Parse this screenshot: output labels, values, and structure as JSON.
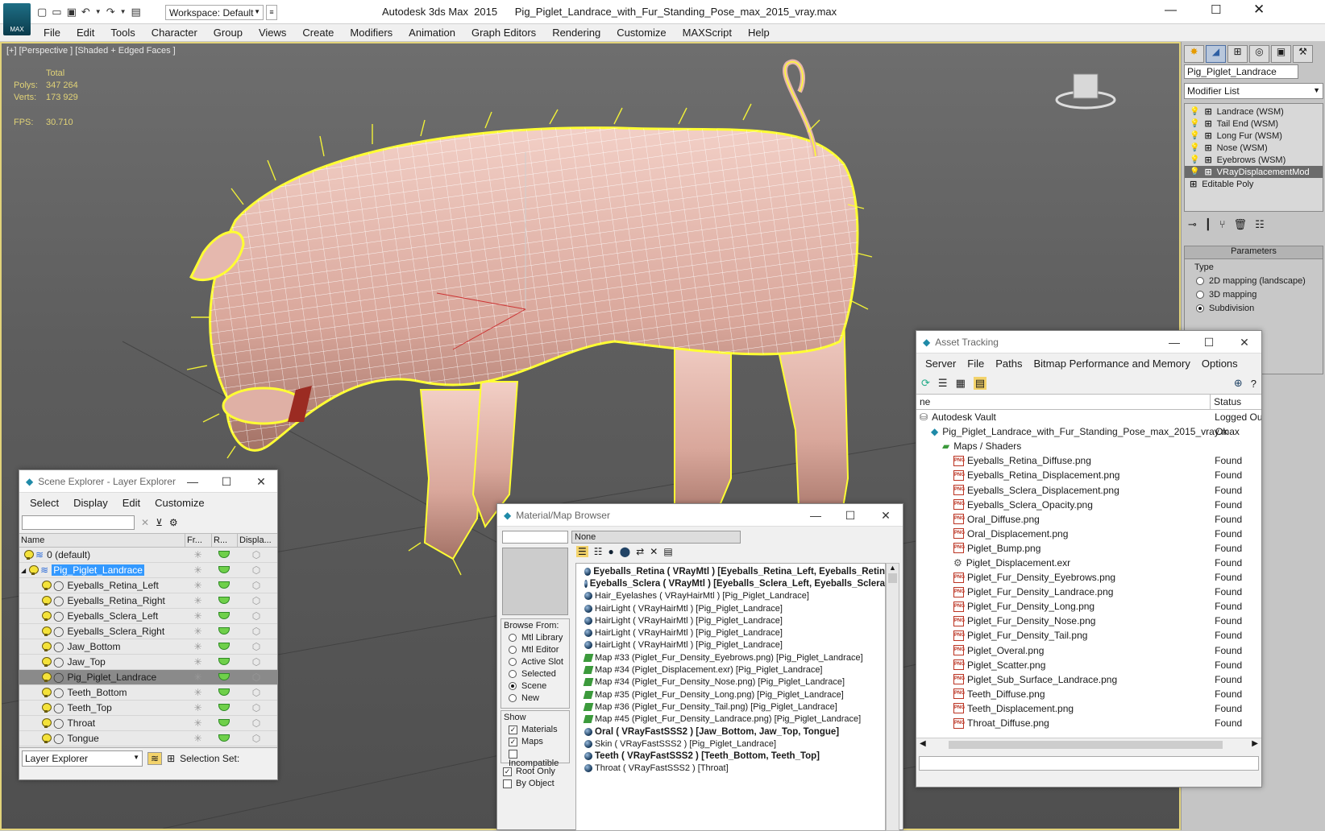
{
  "window": {
    "title": "Autodesk 3ds Max  2015      Pig_Piglet_Landrace_with_Fur_Standing_Pose_max_2015_vray.max",
    "app_logo": "MAX",
    "workspace": "Workspace: Default"
  },
  "menu": [
    "File",
    "Edit",
    "Tools",
    "Character",
    "Group",
    "Views",
    "Create",
    "Modifiers",
    "Animation",
    "Graph Editors",
    "Rendering",
    "Customize",
    "MAXScript",
    "Help"
  ],
  "viewport": {
    "label": "[+] [Perspective ] [Shaded + Edged Faces ]",
    "stats": {
      "total_label": "Total",
      "polys_label": "Polys:",
      "polys": "347 264",
      "verts_label": "Verts:",
      "verts": "173 929",
      "fps_label": "FPS:",
      "fps": "30.710"
    }
  },
  "command_panel": {
    "object_name": "Pig_Piglet_Landrace",
    "modifier_list": "Modifier List",
    "modifiers": [
      "Landrace (WSM)",
      "Tail End (WSM)",
      "Long Fur (WSM)",
      "Nose (WSM)",
      "Eyebrows (WSM)",
      "VRayDisplacementMod",
      "Editable Poly"
    ],
    "selected_modifier": "VRayDisplacementMod",
    "rollout": "Parameters",
    "type_label": "Type",
    "types": [
      "2D mapping (landscape)",
      "3D mapping",
      "Subdivision"
    ],
    "selected_type": "Subdivision"
  },
  "scene_explorer": {
    "title": "Scene Explorer - Layer Explorer",
    "menu": [
      "Select",
      "Display",
      "Edit",
      "Customize"
    ],
    "columns": [
      "Name",
      "Fr...",
      "R...",
      "Displa..."
    ],
    "rows": [
      {
        "name": "0 (default)",
        "level": 0
      },
      {
        "name": "Pig_Piglet_Landrace",
        "level": 0
      },
      {
        "name": "Eyeballs_Retina_Left",
        "level": 1
      },
      {
        "name": "Eyeballs_Retina_Right",
        "level": 1
      },
      {
        "name": "Eyeballs_Sclera_Left",
        "level": 1
      },
      {
        "name": "Eyeballs_Sclera_Right",
        "level": 1
      },
      {
        "name": "Jaw_Bottom",
        "level": 1
      },
      {
        "name": "Jaw_Top",
        "level": 1
      },
      {
        "name": "Pig_Piglet_Landrace",
        "level": 1
      },
      {
        "name": "Teeth_Bottom",
        "level": 1
      },
      {
        "name": "Teeth_Top",
        "level": 1
      },
      {
        "name": "Throat",
        "level": 1
      },
      {
        "name": "Tongue",
        "level": 1
      }
    ],
    "footer_layer": "Layer Explorer",
    "selection_set": "Selection Set:"
  },
  "material_browser": {
    "title": "Material/Map Browser",
    "name_field": "None",
    "browse_from_label": "Browse From:",
    "browse_from": [
      "Mtl Library",
      "Mtl Editor",
      "Active Slot",
      "Selected",
      "Scene",
      "New"
    ],
    "selected_browse": "Scene",
    "show_label": "Show",
    "show": [
      {
        "label": "Materials",
        "checked": true
      },
      {
        "label": "Maps",
        "checked": true
      },
      {
        "label": "Incompatible",
        "checked": false
      }
    ],
    "root_only": "Root Only",
    "by_object": "By Object",
    "items": [
      {
        "text": "Eyeballs_Retina  ( VRayMtl )  [Eyeballs_Retina_Left, Eyeballs_Retin",
        "kind": "mtl",
        "bold": true
      },
      {
        "text": "Eyeballs_Sclera  ( VRayMtl )  [Eyeballs_Sclera_Left, Eyeballs_Sclera",
        "kind": "mtl",
        "bold": true
      },
      {
        "text": "Hair_Eyelashes  ( VRayHairMtl )  [Pig_Piglet_Landrace]",
        "kind": "mtl",
        "bold": false
      },
      {
        "text": "HairLight  ( VRayHairMtl )  [Pig_Piglet_Landrace]",
        "kind": "mtl",
        "bold": false
      },
      {
        "text": "HairLight  ( VRayHairMtl )  [Pig_Piglet_Landrace]",
        "kind": "mtl",
        "bold": false
      },
      {
        "text": "HairLight  ( VRayHairMtl )  [Pig_Piglet_Landrace]",
        "kind": "mtl",
        "bold": false
      },
      {
        "text": "HairLight  ( VRayHairMtl )  [Pig_Piglet_Landrace]",
        "kind": "mtl",
        "bold": false
      },
      {
        "text": "Map #33 (Piglet_Fur_Density_Eyebrows.png)  [Pig_Piglet_Landrace]",
        "kind": "map",
        "bold": false
      },
      {
        "text": "Map #34 (Piglet_Displacement.exr)  [Pig_Piglet_Landrace]",
        "kind": "map",
        "bold": false
      },
      {
        "text": "Map #34 (Piglet_Fur_Density_Nose.png)  [Pig_Piglet_Landrace]",
        "kind": "map",
        "bold": false
      },
      {
        "text": "Map #35 (Piglet_Fur_Density_Long.png)  [Pig_Piglet_Landrace]",
        "kind": "map",
        "bold": false
      },
      {
        "text": "Map #36 (Piglet_Fur_Density_Tail.png)  [Pig_Piglet_Landrace]",
        "kind": "map",
        "bold": false
      },
      {
        "text": "Map #45 (Piglet_Fur_Density_Landrace.png)  [Pig_Piglet_Landrace]",
        "kind": "map",
        "bold": false
      },
      {
        "text": "Oral  ( VRayFastSSS2 )  [Jaw_Bottom, Jaw_Top, Tongue]",
        "kind": "mtl",
        "bold": true
      },
      {
        "text": "Skin  ( VRayFastSSS2 )  [Pig_Piglet_Landrace]",
        "kind": "mtl",
        "bold": false
      },
      {
        "text": "Teeth  ( VRayFastSSS2 )  [Teeth_Bottom, Teeth_Top]",
        "kind": "mtl",
        "bold": true
      },
      {
        "text": "Throat  ( VRayFastSSS2 )  [Throat]",
        "kind": "mtl",
        "bold": false
      }
    ]
  },
  "asset_tracking": {
    "title": "Asset Tracking",
    "menu": [
      "Server",
      "File",
      "Paths",
      "Bitmap Performance and Memory",
      "Options"
    ],
    "col_name": "ne",
    "col_status": "Status",
    "rows": [
      {
        "name": "Autodesk Vault",
        "status": "Logged Ou",
        "icon": "vault",
        "level": 0
      },
      {
        "name": "Pig_Piglet_Landrace_with_Fur_Standing_Pose_max_2015_vray.max",
        "status": "Ok",
        "icon": "max",
        "level": 1
      },
      {
        "name": "Maps / Shaders",
        "status": "",
        "icon": "folder",
        "level": 2
      },
      {
        "name": "Eyeballs_Retina_Diffuse.png",
        "status": "Found",
        "icon": "png",
        "level": 3
      },
      {
        "name": "Eyeballs_Retina_Displacement.png",
        "status": "Found",
        "icon": "png",
        "level": 3
      },
      {
        "name": "Eyeballs_Sclera_Displacement.png",
        "status": "Found",
        "icon": "png",
        "level": 3
      },
      {
        "name": "Eyeballs_Sclera_Opacity.png",
        "status": "Found",
        "icon": "png",
        "level": 3
      },
      {
        "name": "Oral_Diffuse.png",
        "status": "Found",
        "icon": "png",
        "level": 3
      },
      {
        "name": "Oral_Displacement.png",
        "status": "Found",
        "icon": "png",
        "level": 3
      },
      {
        "name": "Piglet_Bump.png",
        "status": "Found",
        "icon": "png",
        "level": 3
      },
      {
        "name": "Piglet_Displacement.exr",
        "status": "Found",
        "icon": "gear",
        "level": 3
      },
      {
        "name": "Piglet_Fur_Density_Eyebrows.png",
        "status": "Found",
        "icon": "png",
        "level": 3
      },
      {
        "name": "Piglet_Fur_Density_Landrace.png",
        "status": "Found",
        "icon": "png",
        "level": 3
      },
      {
        "name": "Piglet_Fur_Density_Long.png",
        "status": "Found",
        "icon": "png",
        "level": 3
      },
      {
        "name": "Piglet_Fur_Density_Nose.png",
        "status": "Found",
        "icon": "png",
        "level": 3
      },
      {
        "name": "Piglet_Fur_Density_Tail.png",
        "status": "Found",
        "icon": "png",
        "level": 3
      },
      {
        "name": "Piglet_Overal.png",
        "status": "Found",
        "icon": "png",
        "level": 3
      },
      {
        "name": "Piglet_Scatter.png",
        "status": "Found",
        "icon": "png",
        "level": 3
      },
      {
        "name": "Piglet_Sub_Surface_Landrace.png",
        "status": "Found",
        "icon": "png",
        "level": 3
      },
      {
        "name": "Teeth_Diffuse.png",
        "status": "Found",
        "icon": "png",
        "level": 3
      },
      {
        "name": "Teeth_Displacement.png",
        "status": "Found",
        "icon": "png",
        "level": 3
      },
      {
        "name": "Throat_Diffuse.png",
        "status": "Found",
        "icon": "png",
        "level": 3
      }
    ]
  },
  "colors": {
    "accent": "#3a7bd5",
    "selected_row": "#3399ff",
    "viewport_border": "#e2d37a",
    "fur": "#ffff33",
    "skin": "#e8b7ac"
  }
}
